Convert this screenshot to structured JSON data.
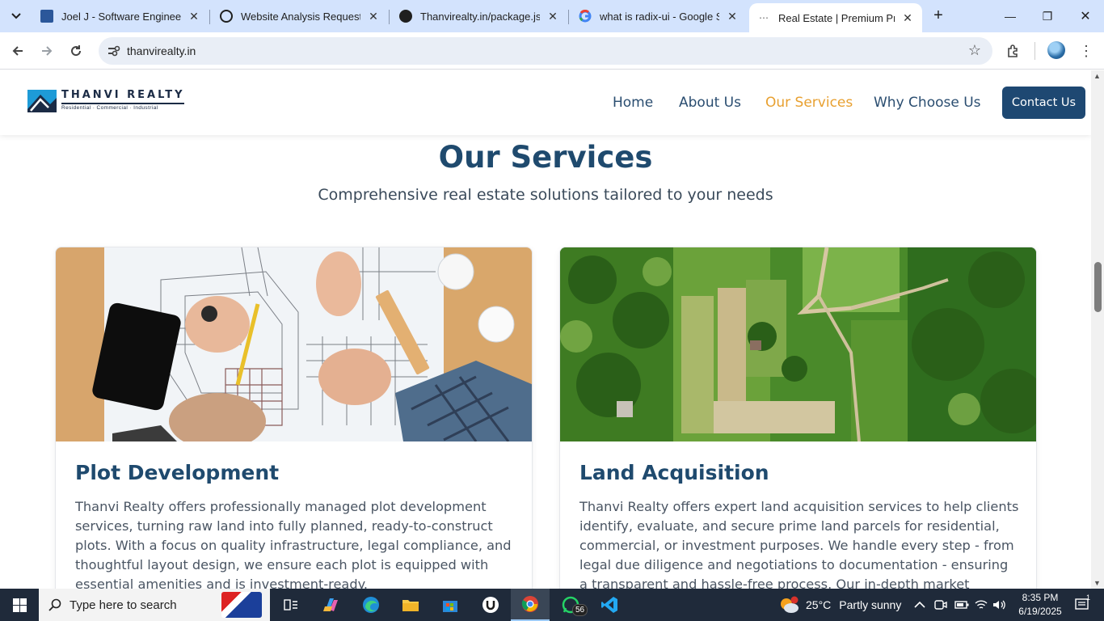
{
  "browser": {
    "tabs": [
      {
        "title": "Joel J - Software Engineer",
        "favicon": "document-icon"
      },
      {
        "title": "Website Analysis Request",
        "favicon": "chatgpt-icon"
      },
      {
        "title": "Thanvirealty.in/package.json",
        "favicon": "github-icon"
      },
      {
        "title": "what is radix-ui - Google Search",
        "favicon": "google-icon"
      },
      {
        "title": "Real Estate | Premium Properties",
        "favicon": "loading-icon"
      }
    ],
    "url": "thanvirealty.in"
  },
  "site": {
    "logo": {
      "name": "THANVI REALTY",
      "tagline": "Residential · Commercial · Industrial"
    },
    "nav": [
      "Home",
      "About Us",
      "Our Services",
      "Why Choose Us"
    ],
    "active_nav": "Our Services",
    "contact_label": "Contact Us",
    "section": {
      "title": "Our Services",
      "subtitle": "Comprehensive real estate solutions tailored to your needs"
    },
    "cards": [
      {
        "title": "Plot Development",
        "text": "Thanvi Realty offers professionally managed plot development services, turning raw land into fully planned, ready-to-construct plots. With a focus on quality infrastructure, legal compliance, and thoughtful layout design, we ensure each plot is equipped with essential amenities and is investment-ready."
      },
      {
        "title": "Land Acquisition",
        "text": "Thanvi Realty offers expert land acquisition services to help clients identify, evaluate, and secure prime land parcels for residential, commercial, or investment purposes. We handle every step - from legal due diligence and negotiations to documentation - ensuring a transparent and hassle-free process. Our in-depth market knowledge"
      }
    ],
    "colors": {
      "primary": "#1f4a6e",
      "accent": "#e8a030",
      "button": "#1e4872"
    }
  },
  "taskbar": {
    "search_placeholder": "Type here to search",
    "whatsapp_badge": "56",
    "weather_temp": "25°C",
    "weather_text": "Partly sunny",
    "time": "8:35 PM",
    "date": "6/19/2025",
    "notification_count": "1"
  }
}
